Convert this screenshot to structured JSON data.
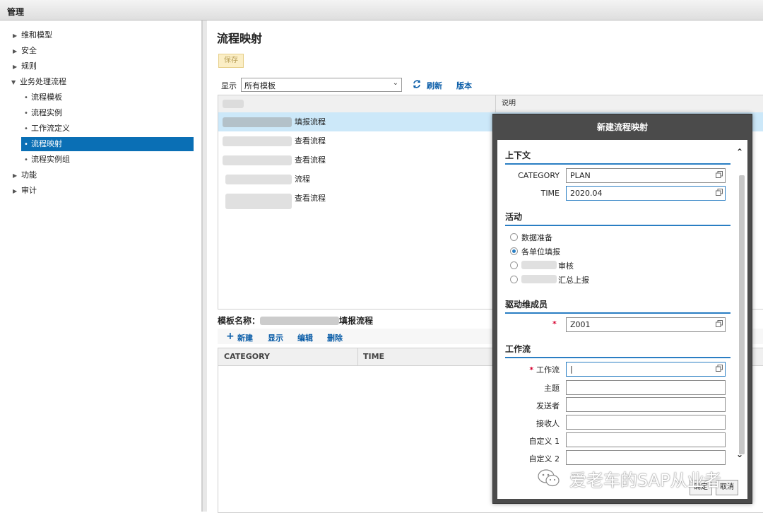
{
  "app": {
    "title": "管理"
  },
  "tree": {
    "items": [
      {
        "label": "维和模型"
      },
      {
        "label": "安全"
      },
      {
        "label": "规则"
      },
      {
        "label": "业务处理流程"
      },
      {
        "label": "流程模板"
      },
      {
        "label": "流程实例"
      },
      {
        "label": "工作流定义"
      },
      {
        "label": "流程映射"
      },
      {
        "label": "流程实例组"
      },
      {
        "label": "功能"
      },
      {
        "label": "审计"
      }
    ]
  },
  "main": {
    "title": "流程映射",
    "save_label": "保存",
    "display_label": "显示",
    "filter_value": "所有模板",
    "refresh_label": "刷新",
    "version_label": "版本",
    "grid": {
      "col_desc": "说明",
      "rows": [
        {
          "name": "填报流程"
        },
        {
          "name": "查看流程"
        },
        {
          "name": "查看流程"
        },
        {
          "name": "流程"
        },
        {
          "name": "查看流程"
        }
      ]
    },
    "sub": {
      "title": "模板名称：",
      "title_suffix": "填报流程",
      "new_label": "新建",
      "show_label": "显示",
      "edit_label": "编辑",
      "delete_label": "删除",
      "col_category": "CATEGORY",
      "col_time": "TIME"
    }
  },
  "dialog": {
    "title": "新建流程映射",
    "context_title": "上下文",
    "category_label": "CATEGORY",
    "category_value": "PLAN",
    "time_label": "TIME",
    "time_value": "2020.04",
    "activity_title": "活动",
    "activities": [
      {
        "label": "数据准备",
        "selected": false
      },
      {
        "label": "各单位填报",
        "selected": true
      },
      {
        "label": "审核",
        "selected": false
      },
      {
        "label": "汇总上报",
        "selected": false
      }
    ],
    "driver_title": "驱动维成员",
    "driver_value": "Z001",
    "workflow_title": "工作流",
    "wf_label": "工作流",
    "wf_value": "|",
    "subject_label": "主题",
    "sender_label": "发送者",
    "receiver_label": "接收人",
    "custom1_label": "自定义 1",
    "custom2_label": "自定义 2",
    "ok_label": "确定",
    "cancel_label": "取消"
  },
  "watermark": {
    "text": "爱老车的SAP从业者"
  },
  "colors": {
    "accent": "#0a6fb5",
    "link": "#0a5da8",
    "dialog_frame": "#4b4b4b",
    "row_selected": "#cce8f9"
  }
}
